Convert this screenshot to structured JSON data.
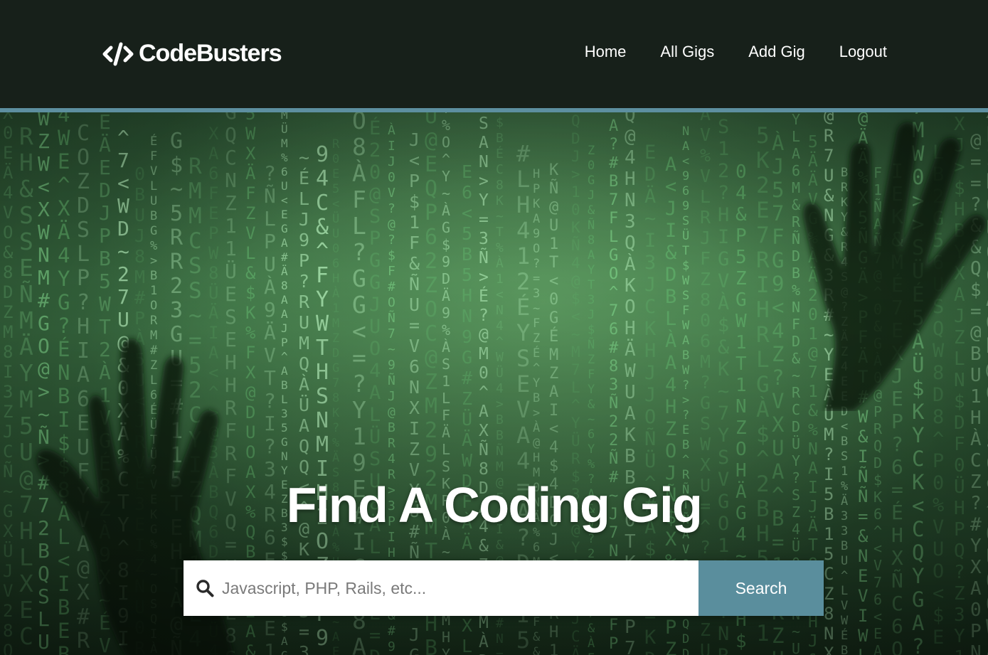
{
  "brand": {
    "name": "CodeBusters",
    "icon": "code-icon"
  },
  "nav": {
    "items": [
      {
        "label": "Home"
      },
      {
        "label": "All Gigs"
      },
      {
        "label": "Add Gig"
      },
      {
        "label": "Logout"
      }
    ]
  },
  "hero": {
    "title": "Find A Coding Gig",
    "background": "matrix-code-rain-with-hands"
  },
  "search": {
    "icon": "search-icon",
    "placeholder": "Javascript, PHP, Rails, etc...",
    "value": "",
    "button_label": "Search"
  },
  "colors": {
    "header_bg": "#17201a",
    "accent": "#5a8e9d",
    "header_border": "#5d8fa0",
    "matrix_green": "#8fe39a"
  }
}
